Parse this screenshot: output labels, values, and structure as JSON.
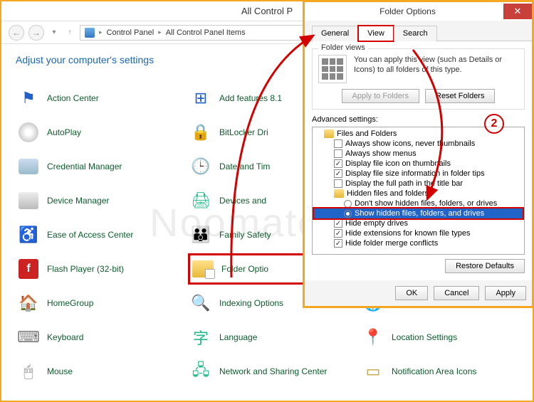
{
  "cp": {
    "title": "All Control P",
    "breadcrumb": {
      "a": "Control Panel",
      "b": "All Control Panel Items"
    },
    "heading": "Adjust your computer's settings",
    "items": [
      [
        "Action Center",
        "AutoPlay",
        "Credential Manager",
        "Device Manager",
        "Ease of Access Center",
        "Flash Player (32-bit)",
        "HomeGroup",
        "Keyboard",
        "Mouse"
      ],
      [
        "Add features 8.1",
        "BitLocker Dri",
        "Date and Tim",
        "Devices and",
        "Family Safety",
        "Folder Optio",
        "Indexing Options",
        "Language",
        "Network and Sharing Center"
      ],
      [
        "",
        "",
        "",
        "",
        "",
        "",
        "Internet Options",
        "Location Settings",
        "Notification Area Icons"
      ]
    ]
  },
  "fo": {
    "title": "Folder Options",
    "tabs": {
      "general": "General",
      "view": "View",
      "search": "Search"
    },
    "fv": {
      "group": "Folder views",
      "text": "You can apply this view (such as Details or Icons) to all folders of this type.",
      "apply": "Apply to Folders",
      "reset": "Reset Folders"
    },
    "adv_label": "Advanced settings:",
    "tree": {
      "root": "Files and Folders",
      "i1": "Always show icons, never thumbnails",
      "i2": "Always show menus",
      "i3": "Display file icon on thumbnails",
      "i4": "Display file size information in folder tips",
      "i5": "Display the full path in the title bar",
      "hidden": "Hidden files and folders",
      "r1": "Don't show hidden files, folders, or drives",
      "r2": "Show hidden files, folders, and drives",
      "i6": "Hide empty drives",
      "i7": "Hide extensions for known file types",
      "i8": "Hide folder merge conflicts"
    },
    "restore": "Restore Defaults",
    "ok": "OK",
    "cancel": "Cancel",
    "apply": "Apply"
  },
  "callout": "2",
  "watermark": "Noomates"
}
